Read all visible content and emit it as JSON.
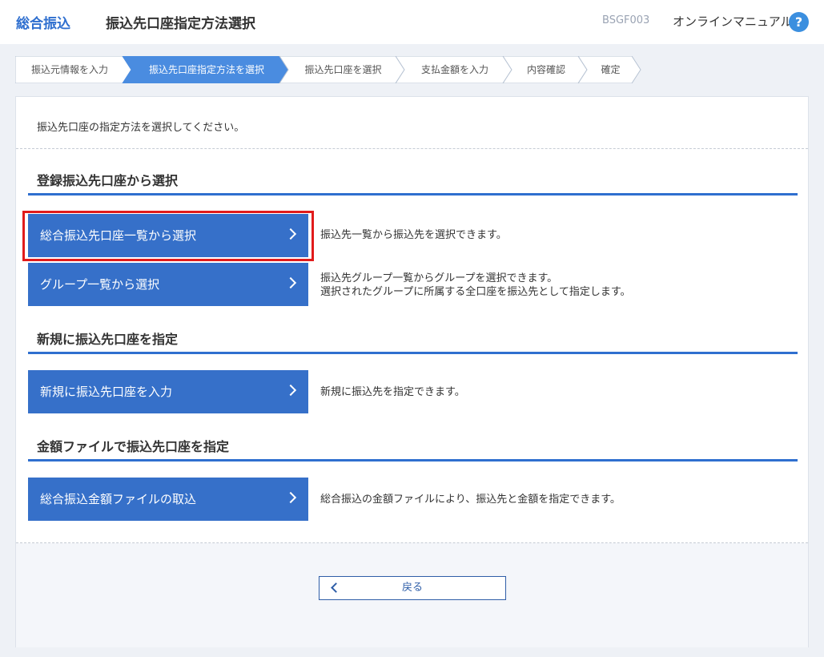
{
  "header": {
    "brand": "総合振込",
    "title": "振込先口座指定方法選択",
    "screen_id": "BSGF003",
    "manual": "オンラインマニュアル",
    "help_glyph": "?"
  },
  "steps": [
    {
      "label": "振込元情報を入力",
      "active": false
    },
    {
      "label": "振込先口座指定方法を選択",
      "active": true
    },
    {
      "label": "振込先口座を選択",
      "active": false
    },
    {
      "label": "支払金額を入力",
      "active": false
    },
    {
      "label": "内容確認",
      "active": false
    },
    {
      "label": "確定",
      "active": false
    }
  ],
  "instruction": "振込先口座の指定方法を選択してください。",
  "sections": [
    {
      "title": "登録振込先口座から選択",
      "options": [
        {
          "label": "総合振込先口座一覧から選択",
          "desc": [
            "振込先一覧から振込先を選択できます。"
          ],
          "highlighted": true
        },
        {
          "label": "グループ一覧から選択",
          "desc": [
            "振込先グループ一覧からグループを選択できます。",
            "選択されたグループに所属する全口座を振込先として指定します。"
          ],
          "highlighted": false
        }
      ]
    },
    {
      "title": "新規に振込先口座を指定",
      "options": [
        {
          "label": "新規に振込先口座を入力",
          "desc": [
            "新規に振込先を指定できます。"
          ],
          "highlighted": false
        }
      ]
    },
    {
      "title": "金額ファイルで振込先口座を指定",
      "options": [
        {
          "label": "総合振込金額ファイルの取込",
          "desc": [
            "総合振込の金額ファイルにより、振込先と金額を指定できます。"
          ],
          "highlighted": false
        }
      ]
    }
  ],
  "back_button": "戻る",
  "colors": {
    "accent": "#3670c9",
    "step_active": "#4a8ce0",
    "highlight": "#e11b1b"
  },
  "icons": {
    "help": "help-circle-icon",
    "option_arrow": "chevron-right-icon",
    "back_arrow": "chevron-left-icon"
  }
}
